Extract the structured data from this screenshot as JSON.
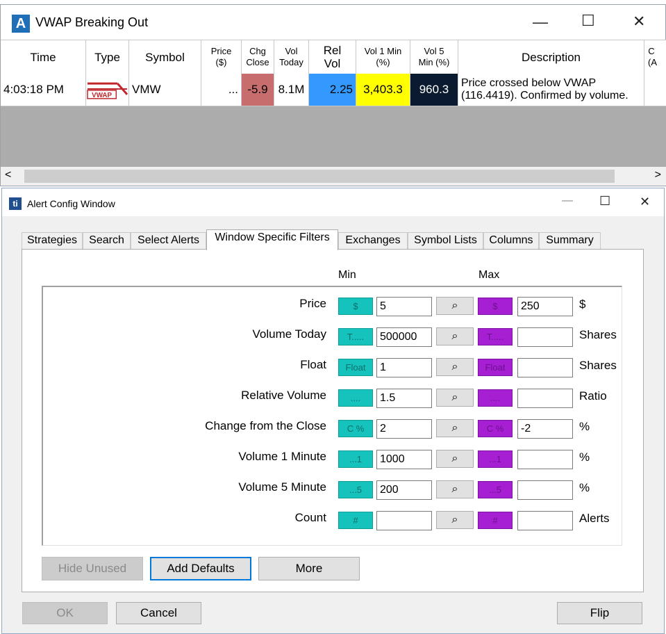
{
  "top_window": {
    "title": "VWAP Breaking Out",
    "logo_letter": "A",
    "controls": {
      "minimize": "—",
      "maximize": "☐",
      "close": "✕"
    },
    "columns": [
      {
        "label": "Time"
      },
      {
        "label": "Type"
      },
      {
        "label": "Symbol"
      },
      {
        "label": "Price ($)"
      },
      {
        "label": "Chg Close"
      },
      {
        "label": "Vol Today"
      },
      {
        "label": "Rel Vol"
      },
      {
        "label": "Vol 1 Min (%)"
      },
      {
        "label": "Vol 5 Min (%)"
      },
      {
        "label": "Description"
      },
      {
        "label": "C (A"
      }
    ],
    "row": {
      "time": "4:03:18 PM",
      "type_icon": "VWAP",
      "symbol": "VMW",
      "price": "...",
      "chg_close": "-5.9",
      "vol_today": "8.1M",
      "rel_vol": "2.25",
      "vol_1min": "3,403.3",
      "vol_5min": "960.3",
      "description": "Price crossed below VWAP (116.4419).  Confirmed by volume."
    },
    "colors": {
      "chg_close": "#c86d6d",
      "rel_vol": "#3399ff",
      "vol_1min": "#ffff00",
      "vol_5min": "#0a1b30"
    },
    "scroll_left": "<",
    "scroll_right": ">"
  },
  "config_window": {
    "title": "Alert Config Window",
    "logo": "ti",
    "controls": {
      "minimize": "—",
      "maximize": "☐",
      "close": "✕"
    },
    "tabs": [
      "Strategies",
      "Search",
      "Select Alerts",
      "Window Specific Filters",
      "Exchanges",
      "Symbol Lists",
      "Columns",
      "Summary"
    ],
    "active_tab": "Window Specific Filters",
    "min_header": "Min",
    "max_header": "Max",
    "filters": [
      {
        "label": "Price",
        "chip": "$",
        "min": "5",
        "max": "250",
        "unit": "$"
      },
      {
        "label": "Volume Today",
        "chip": "T.....",
        "min": "500000",
        "max": "",
        "unit": "Shares"
      },
      {
        "label": "Float",
        "chip": "Float",
        "min": "1",
        "max": "",
        "unit": "Shares"
      },
      {
        "label": "Relative Volume",
        "chip": "....",
        "min": "1.5",
        "max": "",
        "unit": "Ratio"
      },
      {
        "label": "Change from the Close",
        "chip": "C %",
        "min": "2",
        "max": "-2",
        "unit": "%"
      },
      {
        "label": "Volume 1 Minute",
        "chip": "...1",
        "min": "1000",
        "max": "",
        "unit": "%"
      },
      {
        "label": "Volume 5 Minute",
        "chip": "...5",
        "min": "200",
        "max": "",
        "unit": "%"
      },
      {
        "label": "Count",
        "chip": "#",
        "min": "",
        "max": "",
        "unit": "Alerts"
      }
    ],
    "buttons": {
      "hide_unused": "Hide Unused",
      "add_defaults": "Add Defaults",
      "more": "More",
      "ok": "OK",
      "cancel": "Cancel",
      "flip": "Flip"
    }
  }
}
